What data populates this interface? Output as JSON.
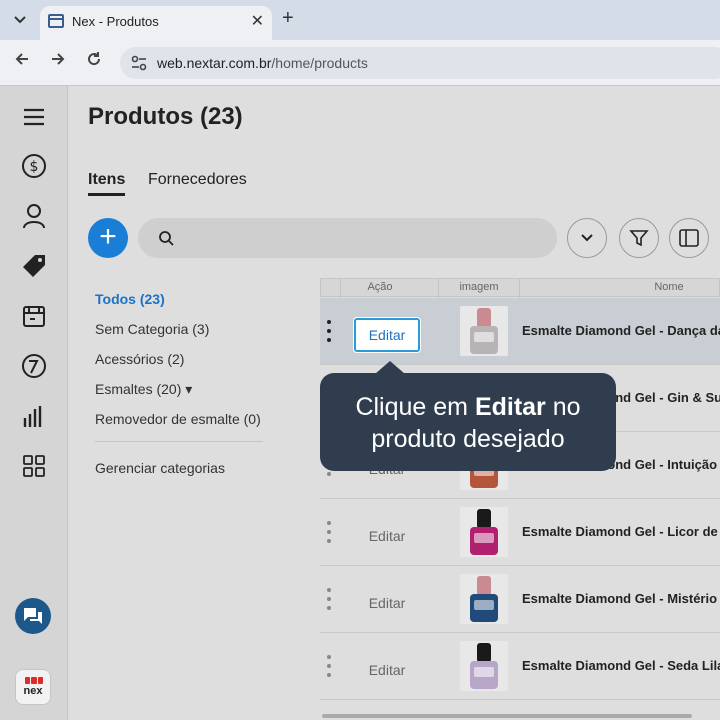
{
  "browser": {
    "tab_title": "Nex - Produtos",
    "tab_close": "✕",
    "new_tab": "+",
    "url_host": "web.nextar.com.br",
    "url_path": "/home/products"
  },
  "page": {
    "title": "Produtos (23)",
    "tabs": [
      "Itens",
      "Fornecedores"
    ]
  },
  "rail": {
    "icons": [
      "menu-icon",
      "dollar-icon",
      "user-icon",
      "tag-icon",
      "store-icon",
      "chart-pie-icon",
      "bar-chart-icon",
      "grid-icon"
    ],
    "chat_icon": "chat-icon",
    "logo_text": "nex"
  },
  "toolbar": {
    "add_label": "+",
    "search_placeholder": ""
  },
  "categories": {
    "items": [
      "Todos (23)",
      "Sem Categoria (3)",
      "Acessórios (2)",
      "Esmaltes (20) ▾",
      "Removedor de esmalte (0)"
    ],
    "manage": "Gerenciar categorias"
  },
  "table": {
    "columns": [
      "Ação",
      "imagem",
      "Nome"
    ],
    "edit_label": "Editar",
    "rows": [
      {
        "name": "Esmalte Diamond Gel - Dança da",
        "cap": "#c98a92",
        "body": "#b8b3b5",
        "selected": true
      },
      {
        "name": "Esmalte Diamond Gel - Gin & Su",
        "cap": "#c98a92",
        "body": "#b8b3b5",
        "selected": false
      },
      {
        "name": "Esmalte Diamond Gel - Intuição",
        "cap": "#c98a92",
        "body": "#b5553a",
        "selected": false
      },
      {
        "name": "Esmalte Diamond Gel - Licor de",
        "cap": "#1a1a1a",
        "body": "#b0206e",
        "selected": false
      },
      {
        "name": "Esmalte Diamond Gel - Mistério",
        "cap": "#c98a92",
        "body": "#1f4a7a",
        "selected": false
      },
      {
        "name": "Esmalte Diamond Gel - Seda Lila",
        "cap": "#1a1a1a",
        "body": "#b7a6c8",
        "selected": false
      }
    ]
  },
  "tooltip": {
    "line1_pre": "Clique em ",
    "line1_bold": "Editar",
    "line1_post": " no",
    "line2": "produto desejado"
  },
  "colors": {
    "accent": "#1a7dd6",
    "tooltip_bg": "#2f3d4e",
    "active_category": "#1a73c5"
  }
}
